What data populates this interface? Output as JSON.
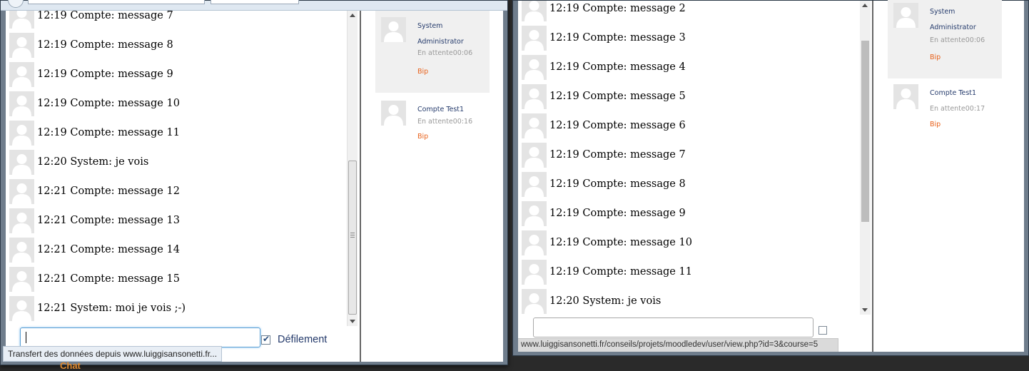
{
  "left_window": {
    "messages": [
      "12:19 Compte: message 7",
      "12:19 Compte: message 8",
      "12:19 Compte: message 9",
      "12:19 Compte: message 10",
      "12:19 Compte: message 11",
      "12:20 System: je vois",
      "12:21 Compte: message 12",
      "12:21 Compte: message 13",
      "12:21 Compte: message 14",
      "12:21 Compte: message 15",
      "12:21 System: moi je vois ;-)"
    ],
    "input_value": "",
    "autoscroll_checked": true,
    "autoscroll_label": "Défilement",
    "status_text": "Transfert des données depuis www.luiggisansonetti.fr...",
    "users": [
      {
        "name": "System Administrator",
        "status": "En attente00:06",
        "bip": "Bip"
      },
      {
        "name": "Compte Test1",
        "status": "En attente00:16",
        "bip": "Bip"
      }
    ]
  },
  "right_window": {
    "messages": [
      "12:19 Compte: message 2",
      "12:19 Compte: message 3",
      "12:19 Compte: message 4",
      "12:19 Compte: message 5",
      "12:19 Compte: message 6",
      "12:19 Compte: message 7",
      "12:19 Compte: message 8",
      "12:19 Compte: message 9",
      "12:19 Compte: message 10",
      "12:19 Compte: message 11",
      "12:20 System: je vois"
    ],
    "input_value": "",
    "autoscroll_checked": false,
    "status_text": "www.luiggisansonetti.fr/conseils/projets/moodledev/user/view.php?id=3&course=5",
    "users": [
      {
        "name": "System Administrator",
        "status": "En attente00:06",
        "bip": "Bip"
      },
      {
        "name": "Compte Test1",
        "status": "En attente00:17",
        "bip": "Bip"
      }
    ]
  },
  "background": {
    "chat_label": "Chat"
  },
  "colors": {
    "link_blue": "#253b6c",
    "bip_orange": "#e8621c",
    "status_gray": "#999999",
    "highlight_bg": "#f0f0f0"
  },
  "icons": {
    "avatar": "default-user-avatar-icon",
    "checkbox": "checkbox-icon"
  }
}
